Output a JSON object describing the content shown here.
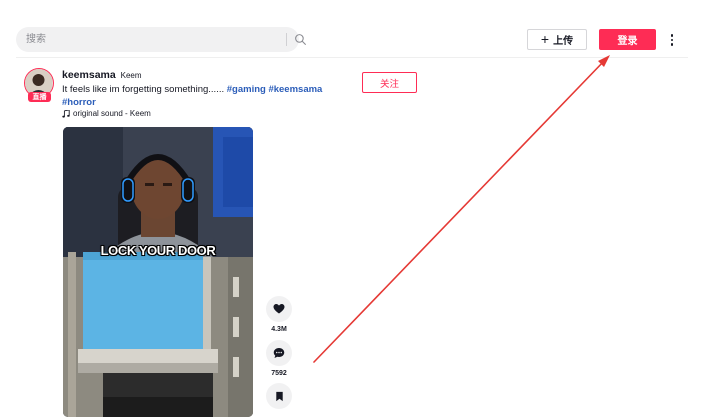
{
  "header": {
    "search_placeholder": "搜索",
    "upload_label": "上传",
    "login_label": "登录"
  },
  "post": {
    "author_name": "keemsama",
    "author_nickname": "Keem",
    "live_badge": "直播",
    "description_text": "It feels like im forgetting something...... ",
    "hashtags": [
      "#gaming",
      "#keemsama",
      "#horror"
    ],
    "music_label": "original sound - Keem",
    "follow_label": "关注",
    "video_caption": "LOCK YOUR DOOR"
  },
  "actions": {
    "likes": "4.3M",
    "comments": "7592"
  },
  "colors": {
    "brand": "#fe2c55",
    "hashtag": "#2b5db9",
    "annotation_arrow": "#e53935"
  },
  "icons": [
    "search-icon",
    "plus-icon",
    "more-icon",
    "music-note-icon",
    "heart-icon",
    "comment-icon",
    "bookmark-icon"
  ]
}
